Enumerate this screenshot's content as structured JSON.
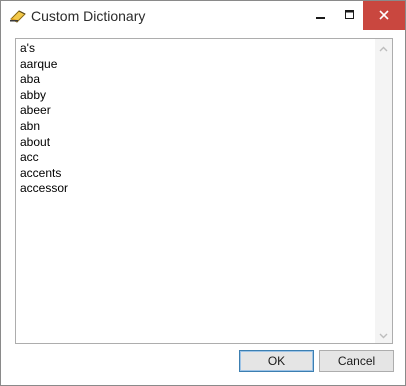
{
  "window": {
    "title": "Custom Dictionary"
  },
  "dictionary": {
    "words": [
      "a's",
      "aarque",
      "aba",
      "abby",
      "abeer",
      "abn",
      "about",
      "acc",
      "accents",
      "accessor"
    ]
  },
  "buttons": {
    "ok_label": "OK",
    "cancel_label": "Cancel"
  },
  "icons": {
    "app": "dictionary-eraser-icon",
    "minimize": "minimize-icon",
    "maximize": "maximize-icon",
    "close": "close-icon",
    "scroll_up": "chevron-up-icon",
    "scroll_down": "chevron-down-icon"
  },
  "colors": {
    "close_button": "#c9473f",
    "ok_border": "#3c7fb1"
  }
}
